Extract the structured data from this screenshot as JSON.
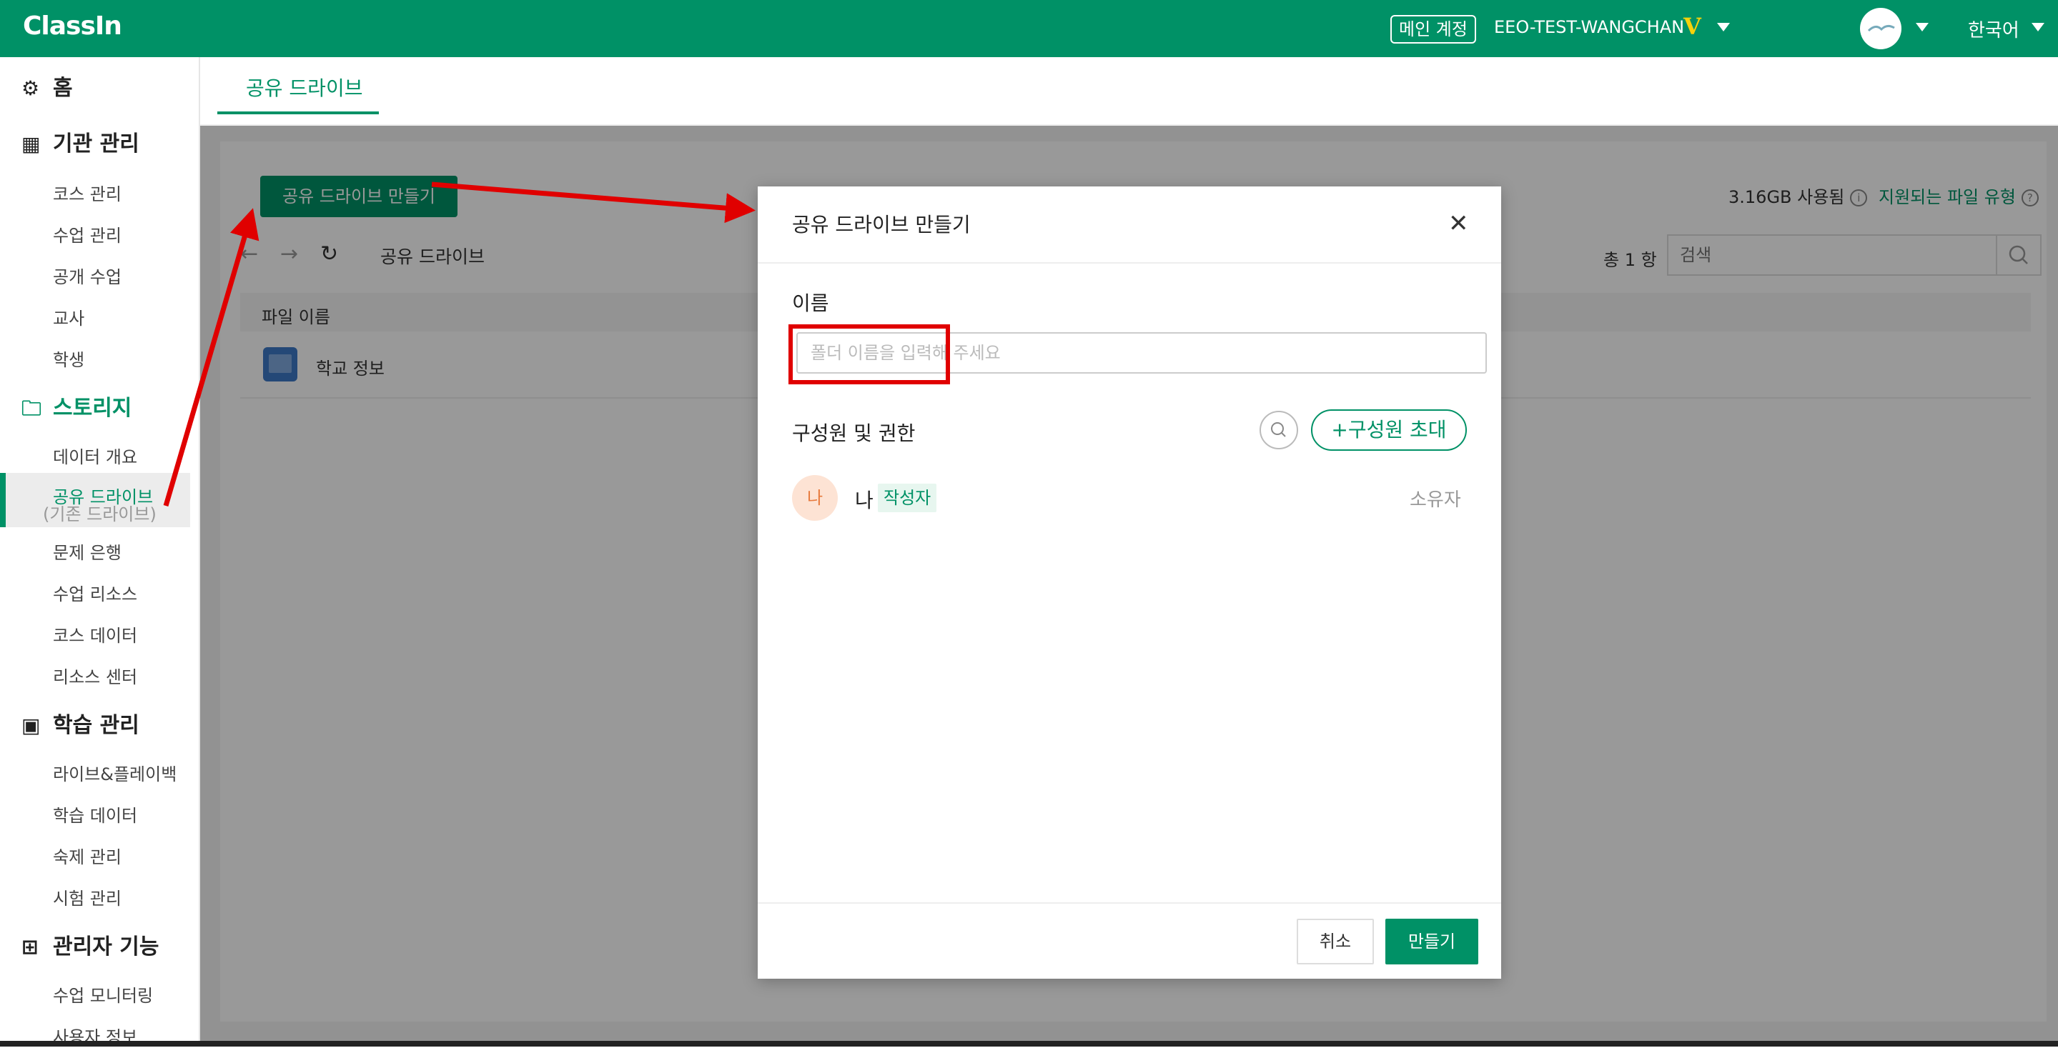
{
  "header": {
    "logo": "ClassIn",
    "account_badge": "메인 계정",
    "account_name": "EEO-TEST-WANGCHAN",
    "vip_mark": "V",
    "language": "한국어"
  },
  "sidebar": {
    "home": "홈",
    "org_title": "기관 관리",
    "org_items": [
      "코스 관리",
      "수업 관리",
      "공개 수업",
      "교사",
      "학생"
    ],
    "storage_title": "스토리지",
    "storage_items": [
      "데이터 개요",
      "공유 드라이브",
      "(기존 드라이브)",
      "문제 은행",
      "수업 리소스",
      "코스 데이터",
      "리소스 센터"
    ],
    "learning_title": "학습 관리",
    "learning_items": [
      "라이브&플레이백",
      "학습 데이터",
      "숙제 관리",
      "시험 관리"
    ],
    "admin_title": "관리자 기능",
    "admin_items": [
      "수업 모니터링",
      "사용자 정보"
    ]
  },
  "main": {
    "tab": "공유 드라이브",
    "create_button": "공유 드라이브 만들기",
    "storage_used": "3.16GB 사용됨",
    "supported_types": "지원되는 파일 유형",
    "breadcrumb": "공유 드라이브",
    "total_count": "총 1 항",
    "search_placeholder": "검색",
    "column_filename": "파일 이름",
    "rows": [
      "학교 정보"
    ]
  },
  "modal": {
    "title": "공유 드라이브 만들기",
    "name_label": "이름",
    "name_placeholder": "폴더 이름을 입력해 주세요",
    "members_label": "구성원 및 권한",
    "invite_button": "+구성원 초대",
    "member_avatar": "나",
    "member_name": "나",
    "member_badge": "작성자",
    "member_role": "소유자",
    "cancel_button": "취소",
    "create_button": "만들기"
  },
  "colors": {
    "brand": "#009166",
    "annotation": "#e00000"
  }
}
